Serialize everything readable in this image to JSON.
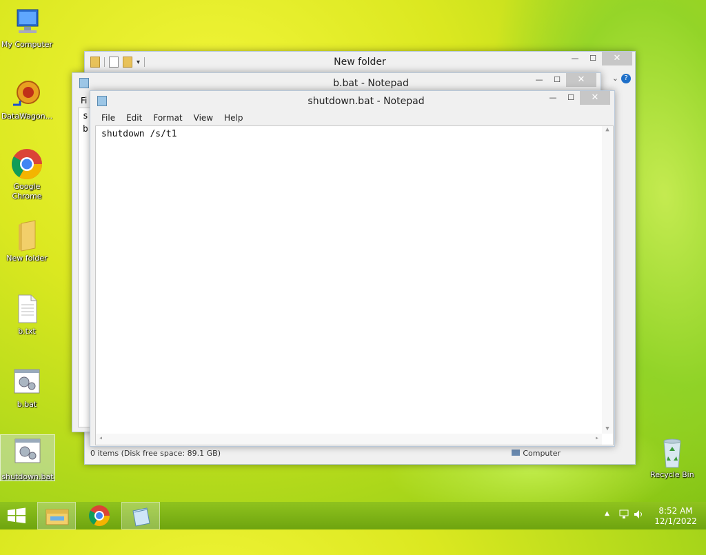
{
  "desktop": {
    "icons": [
      {
        "label": "My Computer"
      },
      {
        "label": "DataWagon..."
      },
      {
        "label": "Google Chrome"
      },
      {
        "label": "New folder"
      },
      {
        "label": "b.txt"
      },
      {
        "label": "b.bat"
      },
      {
        "label": "shutdown.bat"
      },
      {
        "label": "Recycle Bin"
      }
    ]
  },
  "explorer": {
    "title": "New folder",
    "menu_partial": "Fi",
    "status_items": "0 items (Disk free space: 89.1 GB)",
    "status_location": "Computer"
  },
  "notepad_b": {
    "title": "b.bat - Notepad",
    "text_line1": "s",
    "text_line2": "b"
  },
  "notepad_main": {
    "title": "shutdown.bat - Notepad",
    "menu": [
      "File",
      "Edit",
      "Format",
      "View",
      "Help"
    ],
    "content": "shutdown /s/t1"
  },
  "taskbar": {
    "time": "8:52 AM",
    "date": "12/1/2022"
  },
  "colors": {
    "taskbar": "#7fb418",
    "close_button": "#c7c7c7"
  }
}
